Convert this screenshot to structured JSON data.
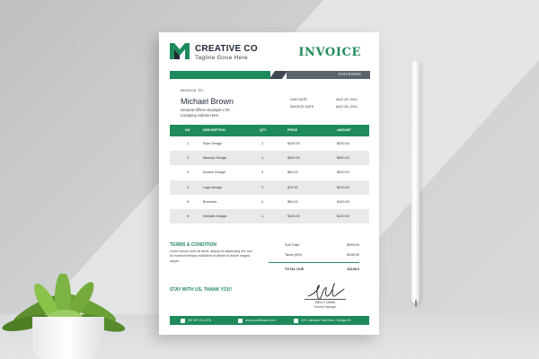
{
  "company": {
    "name": "CREATIVE CO",
    "tagline": "Tagline Gose Here"
  },
  "invoice": {
    "title": "INVOICE",
    "number": "#INV00998"
  },
  "client": {
    "label": "INVOICE TO :",
    "name": "Michael Brown",
    "position": "General Officer Example LTD",
    "address": "Company Adress Here"
  },
  "dates": [
    {
      "label": "DUE DATE",
      "value": "AUG 25, 2021"
    },
    {
      "label": "INVOICE DATE",
      "value": "AUG 25, 2021"
    }
  ],
  "table": {
    "headers": [
      "NO",
      "DESCRIPTION",
      "QTY",
      "PRICE",
      "AMOUNT"
    ],
    "rows": [
      [
        "1",
        "Flyer Design",
        "2",
        "$100.00",
        "$200.00"
      ],
      [
        "2",
        "Mockup Design",
        "1",
        "$300.00",
        "$300.00"
      ],
      [
        "3",
        "Invoice Design",
        "4",
        "$50.00",
        "$200.00"
      ],
      [
        "4",
        "Logo Design",
        "3",
        "$70.00",
        "$210.00"
      ],
      [
        "5",
        "Brochure",
        "2",
        "$50.00",
        "$100.00"
      ],
      [
        "6",
        "Website Design",
        "1",
        "$100.00",
        "$100.00"
      ]
    ]
  },
  "terms": {
    "heading": "TERMS & CONDITION",
    "text": "Lorem ipsum dolor sit amet, aliquip ex adipisicing elit, sed do eiusmod tempor incididunt ut labore et dolore magna aliqua"
  },
  "totals": [
    {
      "label": "Sub Total",
      "value": "$993.00"
    },
    {
      "label": "Taxes (5%)",
      "value": "$198.00"
    },
    {
      "label": "TOTAL DUE",
      "value": "$1198.0"
    }
  ],
  "thanks": "STAY WITH US, THANK YOU!",
  "signature": {
    "name": "NELLY DEAN",
    "role": "General Manager"
  },
  "footer": {
    "phone": "387 387 234 2378",
    "email": "www.yoursitename.com",
    "address": "1071 Lakeland Park Drive, Chicago US"
  },
  "colors": {
    "brand": "#1f8a5c",
    "dark": "#3f4750",
    "gray": "#5b636c"
  },
  "icons": {
    "logo": "m-logo-icon",
    "phone": "phone-icon",
    "email": "email-icon",
    "location": "location-icon"
  }
}
